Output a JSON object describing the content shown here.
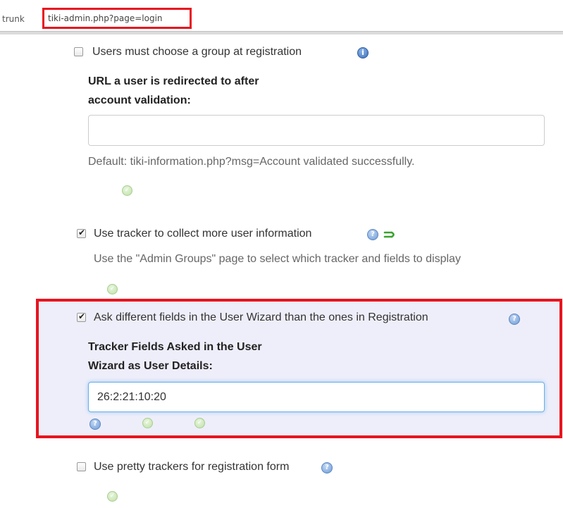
{
  "url_bar": {
    "path_fragment": "trunk",
    "url": "tiki-admin.php?page=login"
  },
  "settings": {
    "group_at_registration": {
      "label": "Users must choose a group at registration",
      "checked": false,
      "icon": "info-icon"
    },
    "redirect_url": {
      "label_line1": "URL a user is redirected to after",
      "label_line2": "account validation:",
      "value": "",
      "default_hint": "Default: tiki-information.php?msg=Account validated successfully."
    },
    "use_tracker": {
      "label": "Use tracker to collect more user information",
      "checked": true,
      "hint": "Use the \"Admin Groups\" page to select which tracker and fields to display",
      "icons": [
        "help-icon",
        "apply-arrow-icon"
      ]
    },
    "wizard_fields": {
      "label": "Ask different fields in the User Wizard than the ones in Registration",
      "checked": true,
      "field_label_line1": "Tracker Fields Asked in the User",
      "field_label_line2": "Wizard as User Details:",
      "value": "26:2:21:10:20",
      "highlight_color": "#e8141f",
      "background_color": "#eeeefa"
    },
    "pretty_trackers": {
      "label": "Use pretty trackers for registration form",
      "checked": false
    }
  }
}
